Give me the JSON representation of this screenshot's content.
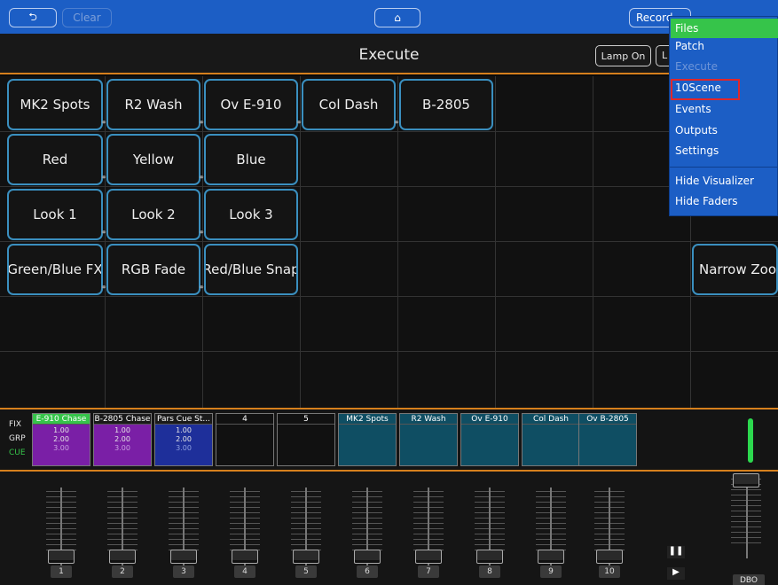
{
  "topbar": {
    "back_label": "⮌",
    "clear_label": "Clear",
    "home_label": "⌂",
    "record_label": "Record"
  },
  "title": "Execute",
  "lamp_label": "Lamp On",
  "extra_label": "L",
  "grid": {
    "row1": [
      "MK2 Spots",
      "R2 Wash",
      "Ov E-910",
      "Col Dash",
      "B-2805"
    ],
    "row2": [
      "Red",
      "Yellow",
      "Blue"
    ],
    "row3": [
      "Look 1",
      "Look 2",
      "Look 3"
    ],
    "row4": [
      "Green/Blue FX",
      "RGB Fade",
      "Red/Blue Snap"
    ],
    "far_right": "Narrow Zoom"
  },
  "strip": {
    "modes": [
      "FIX",
      "GRP",
      "CUE"
    ],
    "slots": [
      {
        "label": "E-910 Chase",
        "v1": "1.00",
        "v2": "2.00",
        "v3": "3.00"
      },
      {
        "label": "B-2805 Chase",
        "v1": "1.00",
        "v2": "2.00",
        "v3": "3.00"
      },
      {
        "label": "Pars Cue St...",
        "v1": "1.00",
        "v2": "2.00",
        "v3": "3.00"
      },
      {
        "label": "4"
      },
      {
        "label": "5"
      },
      {
        "label": "MK2 Spots"
      },
      {
        "label": "R2 Wash"
      },
      {
        "label": "Ov E-910"
      },
      {
        "label": "Col Dash"
      },
      {
        "label": "Ov B-2805"
      }
    ]
  },
  "faders": {
    "numbers": [
      "1",
      "2",
      "3",
      "4",
      "5",
      "6",
      "7",
      "8",
      "9",
      "10"
    ],
    "pause_label": "❚❚",
    "play_label": "▶",
    "dbo_label": "DBO"
  },
  "menu": {
    "items": [
      "Files",
      "Patch",
      "Execute",
      "10Scene",
      "Events",
      "Outputs",
      "Settings",
      "Hide Visualizer",
      "Hide Faders"
    ]
  },
  "colors": {
    "topbar": "#1c5ec5",
    "accent_orange": "#d6801d",
    "button_border": "#3a8fbf",
    "menu_active": "#36c44a",
    "highlight": "#e0272a"
  }
}
